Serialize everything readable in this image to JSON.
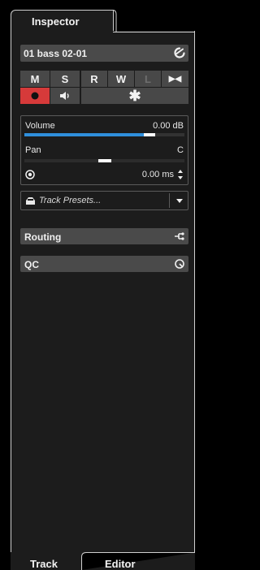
{
  "header": {
    "inspector_tab": "Inspector"
  },
  "track": {
    "name": "01 bass 02-01"
  },
  "buttons": {
    "mute": "M",
    "solo": "S",
    "read": "R",
    "write": "W",
    "lock": "L",
    "freeze": "▶◀",
    "punch": "✱"
  },
  "volume": {
    "label": "Volume",
    "value": "0.00 dB",
    "level": 0.78
  },
  "pan": {
    "label": "Pan",
    "value": "C",
    "position": 0.5
  },
  "delay": {
    "value": "0.00 ms"
  },
  "presets": {
    "placeholder": "Track Presets..."
  },
  "sections": {
    "routing": "Routing",
    "qc": "QC"
  },
  "bottom_tabs": {
    "track": "Track",
    "editor": "Editor"
  },
  "colors": {
    "record_red": "#d63a3a",
    "meter_blue": "#2f8fdc",
    "panel_gray": "#4a4a4a"
  }
}
